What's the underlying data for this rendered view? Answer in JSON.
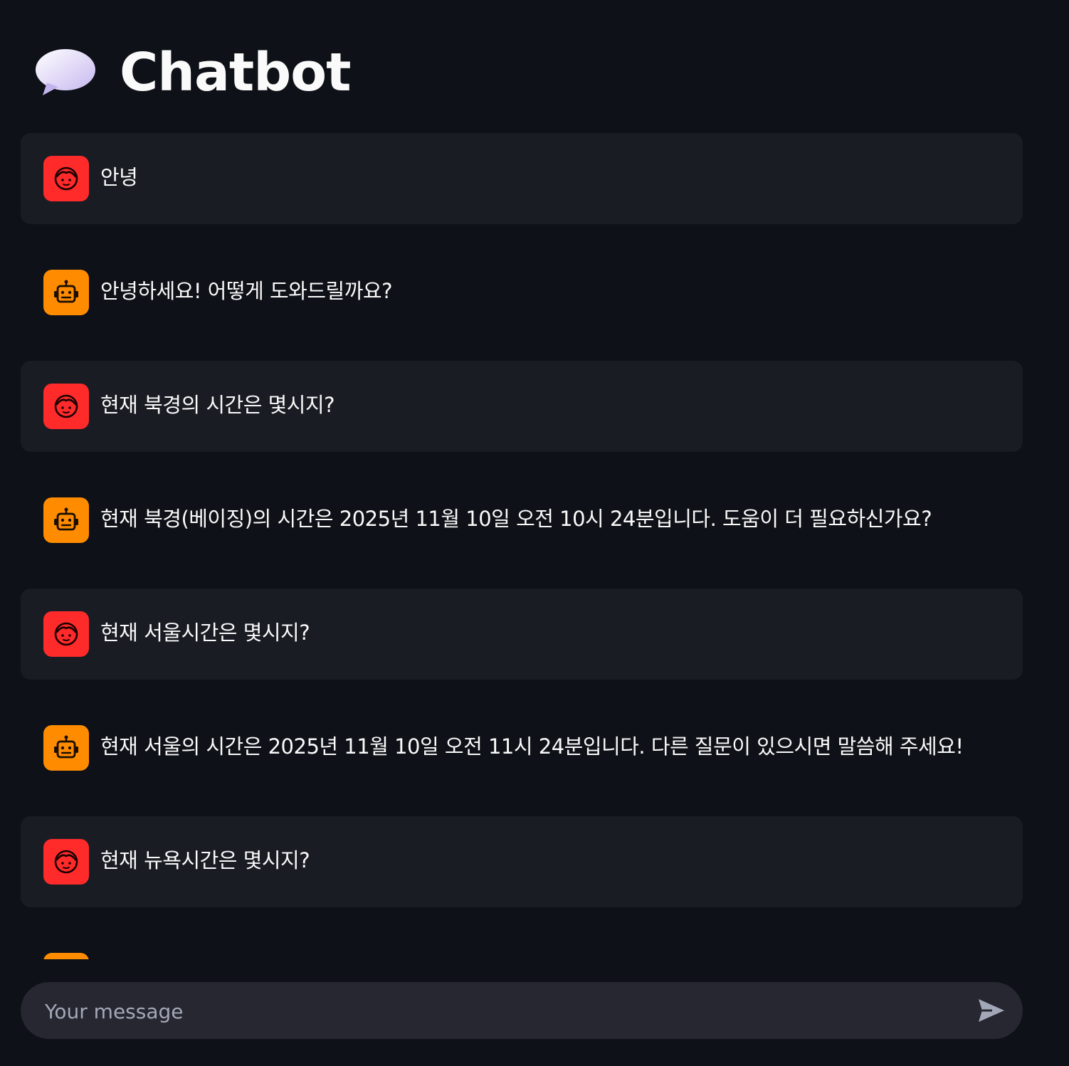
{
  "app": {
    "title": "Chatbot",
    "title_icon": "speech-balloon-icon"
  },
  "colors": {
    "background": "#0e1117",
    "user_message_bg": "#1a1c24",
    "user_avatar": "#ff2b2b",
    "assistant_avatar": "#ff8c00",
    "input_bg": "#262730",
    "text": "#fafafa"
  },
  "messages": [
    {
      "role": "user",
      "avatar_icon": "user-face-icon",
      "text": "안녕"
    },
    {
      "role": "assistant",
      "avatar_icon": "robot-icon",
      "text": "안녕하세요! 어떻게 도와드릴까요?"
    },
    {
      "role": "user",
      "avatar_icon": "user-face-icon",
      "text": "현재 북경의 시간은 몇시지?"
    },
    {
      "role": "assistant",
      "avatar_icon": "robot-icon",
      "text": "현재 북경(베이징)의 시간은 2025년 11월 10일 오전 10시 24분입니다. 도움이 더 필요하신가요?"
    },
    {
      "role": "user",
      "avatar_icon": "user-face-icon",
      "text": "현재 서울시간은 몇시지?"
    },
    {
      "role": "assistant",
      "avatar_icon": "robot-icon",
      "text": "현재 서울의 시간은 2025년 11월 10일 오전 11시 24분입니다. 다른 질문이 있으시면 말씀해 주세요!"
    },
    {
      "role": "user",
      "avatar_icon": "user-face-icon",
      "text": "현재 뉴욕시간은 몇시지?"
    },
    {
      "role": "assistant",
      "avatar_icon": "robot-icon",
      "text": ""
    }
  ],
  "chat_input": {
    "placeholder": "Your message",
    "value": "",
    "send_icon": "send-arrow-icon"
  }
}
